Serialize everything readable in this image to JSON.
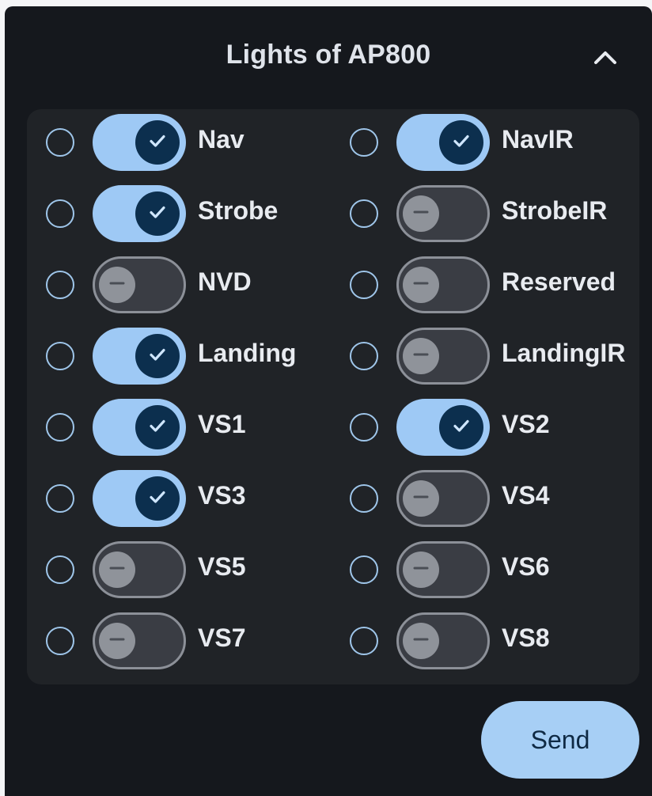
{
  "title": "Lights of AP800",
  "send_label": "Send",
  "colors": {
    "panel": "#15181d",
    "grid": "#202327",
    "toggle_on": "#9ec9f5",
    "knob_on": "#0c2f4e",
    "toggle_off": "#3a3d44",
    "knob_off": "#8f939a",
    "radio": "#9fc6ea",
    "button": "#a7cff5"
  },
  "lights": [
    {
      "label": "Nav",
      "on": true
    },
    {
      "label": "NavIR",
      "on": true
    },
    {
      "label": "Strobe",
      "on": true
    },
    {
      "label": "StrobeIR",
      "on": false
    },
    {
      "label": "NVD",
      "on": false
    },
    {
      "label": "Reserved",
      "on": false
    },
    {
      "label": "Landing",
      "on": true
    },
    {
      "label": "LandingIR",
      "on": false
    },
    {
      "label": "VS1",
      "on": true
    },
    {
      "label": "VS2",
      "on": true
    },
    {
      "label": "VS3",
      "on": true
    },
    {
      "label": "VS4",
      "on": false
    },
    {
      "label": "VS5",
      "on": false
    },
    {
      "label": "VS6",
      "on": false
    },
    {
      "label": "VS7",
      "on": false
    },
    {
      "label": "VS8",
      "on": false
    }
  ]
}
